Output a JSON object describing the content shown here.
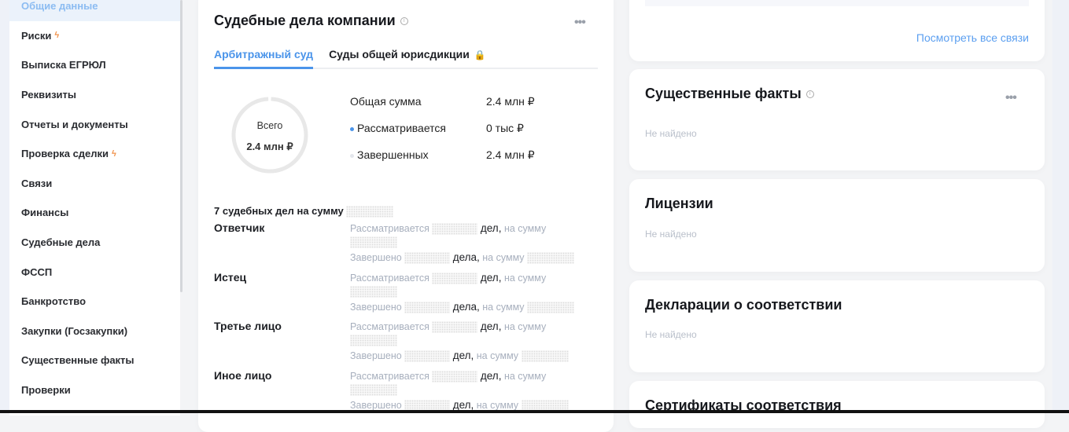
{
  "sidebar": {
    "items": [
      {
        "label": "Общие данные",
        "active": true
      },
      {
        "label": "Риски",
        "bolt": true
      },
      {
        "label": "Выписка ЕГРЮЛ"
      },
      {
        "label": "Реквизиты"
      },
      {
        "label": "Отчеты и документы"
      },
      {
        "label": "Проверка сделки",
        "bolt": true
      },
      {
        "label": "Связи"
      },
      {
        "label": "Финансы"
      },
      {
        "label": "Судебные дела"
      },
      {
        "label": "ФССП"
      },
      {
        "label": "Банкротство"
      },
      {
        "label": "Закупки (Госзакупки)"
      },
      {
        "label": "Существенные факты"
      },
      {
        "label": "Проверки"
      }
    ]
  },
  "court": {
    "title": "Судебные дела компании",
    "tabs": [
      "Арбитражный суд",
      "Суды общей юрисдикции"
    ],
    "donut": {
      "label": "Всего",
      "value": "2.4 млн ₽",
      "active_fraction": 0
    },
    "stats": [
      {
        "label": "Общая сумма",
        "value": "2.4 млн ₽"
      },
      {
        "label": "Рассматривается",
        "value": "0 тыс ₽",
        "color": "#4a94ea"
      },
      {
        "label": "Завершенных",
        "value": "2.4 млн ₽",
        "color": "#e3e6ec"
      }
    ],
    "summary": "7 судебных дел на сумму",
    "parties": [
      {
        "name": "Ответчик",
        "pending": "Рассматривается",
        "pending_unit": "дел,",
        "done": "Завершено",
        "done_unit": "дела,"
      },
      {
        "name": "Истец",
        "pending": "Рассматривается",
        "pending_unit": "дел,",
        "done": "Завершено",
        "done_unit": "дела,"
      },
      {
        "name": "Третье лицо",
        "pending": "Рассматривается",
        "pending_unit": "дел,",
        "done": "Завершено",
        "done_unit": "дел,"
      },
      {
        "name": "Иное лицо",
        "pending": "Рассматривается",
        "pending_unit": "дел,",
        "done": "Завершено",
        "done_unit": "дел,"
      }
    ],
    "sum_label": "на сумму"
  },
  "links": {
    "view_all": "Посмотреть все связи"
  },
  "facts": {
    "title": "Существенные факты",
    "empty": "Не найдено"
  },
  "licenses": {
    "title": "Лицензии",
    "empty": "Не найдено"
  },
  "declarations": {
    "title": "Декларации о соответствии",
    "empty": "Не найдено"
  },
  "certificates": {
    "title": "Сертификаты соответствия"
  }
}
